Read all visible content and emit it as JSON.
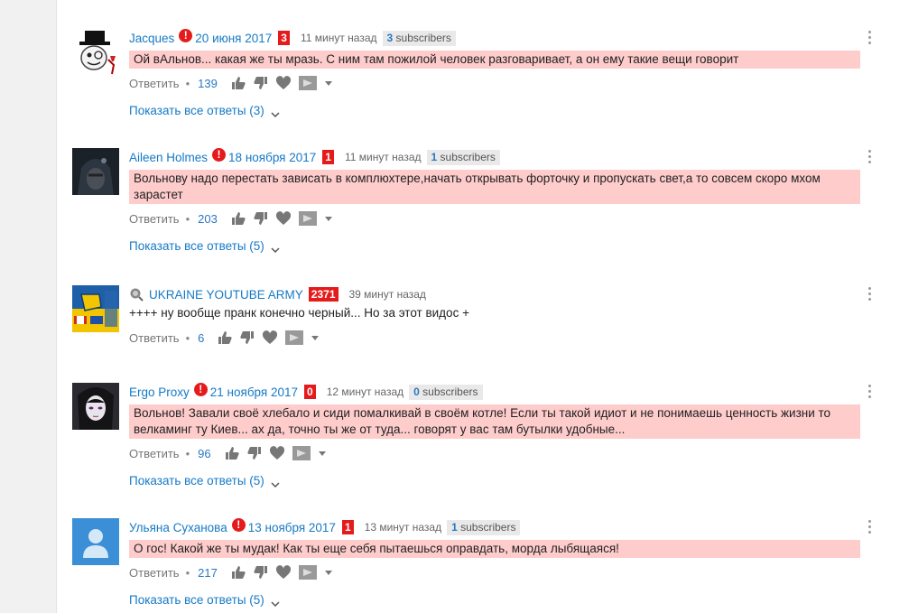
{
  "labels": {
    "reply": "Ответить",
    "dot": "•",
    "exclamation": "!"
  },
  "comments": [
    {
      "author": "Jacques",
      "date": "20 июня 2017",
      "badge": "3",
      "time": "11 минут назад",
      "subs_count": "3",
      "subs_label": "subscribers",
      "text": "Ой вАльнов... какая же ты мразь. С ним там пожилой человек разговаривает, а он ему такие вещи говорит",
      "likes": "139",
      "show_replies": "Показать все ответы (3)"
    },
    {
      "author": "Aileen Holmes",
      "date": "18 ноября 2017",
      "badge": "1",
      "time": "11 минут назад",
      "subs_count": "1",
      "subs_label": "subscribers",
      "text": "Вольнову надо перестать зависать в комплюхтере,начать открывать форточку и пропускать свет,а то совсем скоро мхом зарастет",
      "likes": "203",
      "show_replies": "Показать все ответы (5)"
    },
    {
      "author": "UKRAINE YOUTUBE ARMY",
      "badge": "2371",
      "time": "39 минут назад",
      "text": "++++ ну вообще пранк конечно черный... Но за этот видос +",
      "likes": "6"
    },
    {
      "author": "Ergo Proxy",
      "date": "21 ноября 2017",
      "badge": "0",
      "time": "12 минут назад",
      "subs_count": "0",
      "subs_label": "subscribers",
      "text": "Вольнов! Завали своё хлебало и сиди помалкивай в своём котле! Если ты такой идиот и не понимаешь ценность жизни то велкаминг ту Киев... ах да, точно ты же от туда... говорят у вас там бутылки удобные...",
      "likes": "96",
      "show_replies": "Показать все ответы (5)"
    },
    {
      "author": "Ульяна Суханова",
      "date": "13 ноября 2017",
      "badge": "1",
      "time": "13 минут назад",
      "subs_count": "1",
      "subs_label": "subscribers",
      "text": "О гос! Какой же ты мудак! Как ты еще себя пытаешься оправдать, морда лыбящаяся!",
      "likes": "217",
      "show_replies": "Показать все ответы (5)"
    }
  ],
  "colors": {
    "link": "#167ac6",
    "highlight": "#ffcccc",
    "badge_red": "#e51b1b"
  }
}
